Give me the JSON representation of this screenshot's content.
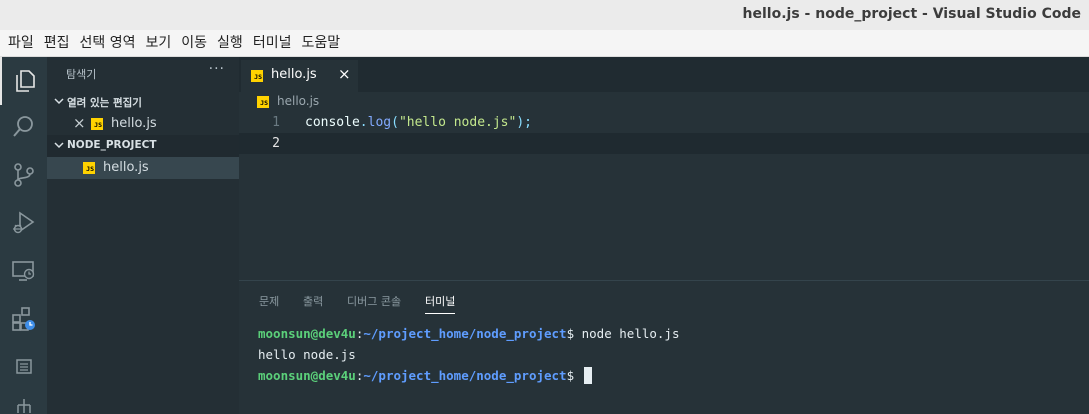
{
  "window": {
    "title": "hello.js - node_project - Visual Studio Code"
  },
  "menubar": {
    "items": [
      "파일",
      "편집",
      "선택 영역",
      "보기",
      "이동",
      "실행",
      "터미널",
      "도움말"
    ]
  },
  "activitybar": {
    "items": [
      {
        "icon": "files-icon",
        "active": true
      },
      {
        "icon": "search-icon",
        "active": false
      },
      {
        "icon": "source-control-icon",
        "active": false
      },
      {
        "icon": "run-debug-icon",
        "active": false
      },
      {
        "icon": "remote-explorer-icon",
        "active": false
      },
      {
        "icon": "extensions-icon",
        "active": false
      },
      {
        "icon": "outline-icon",
        "active": false
      },
      {
        "icon": "tree-icon",
        "active": false
      }
    ]
  },
  "sidebar": {
    "title": "탐색기",
    "more": "···",
    "open_editors": {
      "label": "열려 있는 편집기",
      "files": [
        {
          "name": "hello.js",
          "icon_text": "JS",
          "close": "×"
        }
      ]
    },
    "project": {
      "label": "NODE_PROJECT",
      "files": [
        {
          "name": "hello.js",
          "icon_text": "JS"
        }
      ]
    }
  },
  "tabs": [
    {
      "label": "hello.js",
      "icon_text": "JS",
      "close": "×",
      "active": true
    }
  ],
  "breadcrumb": {
    "file": "hello.js",
    "icon_text": "JS"
  },
  "editor": {
    "lines": [
      {
        "number": "1",
        "obj": "console",
        "dot": ".",
        "fn": "log",
        "open": "(",
        "str": "\"hello node.js\"",
        "close": ")",
        "semi": ";"
      },
      {
        "number": "2"
      }
    ],
    "current_line": 2
  },
  "panel": {
    "tabs": [
      "문제",
      "출력",
      "디버그 콘솔",
      "터미널"
    ],
    "active_tab": "터미널",
    "terminal": {
      "lines": [
        {
          "user": "moonsun@dev4u",
          "sep": ":",
          "path": "~/project_home/node_project",
          "prompt": "$",
          "cmd": " node hello.js"
        },
        {
          "output": "hello node.js"
        },
        {
          "user": "moonsun@dev4u",
          "sep": ":",
          "path": "~/project_home/node_project",
          "prompt": "$",
          "cmd": " "
        }
      ]
    }
  },
  "colors": {
    "editor_bg": "#263238",
    "sidebar_bg": "#242f35",
    "activitybar_bg": "#2b3a41",
    "js_icon": "#ffd200",
    "terminal_user": "#5bd07a",
    "terminal_path": "#5f9dff"
  }
}
